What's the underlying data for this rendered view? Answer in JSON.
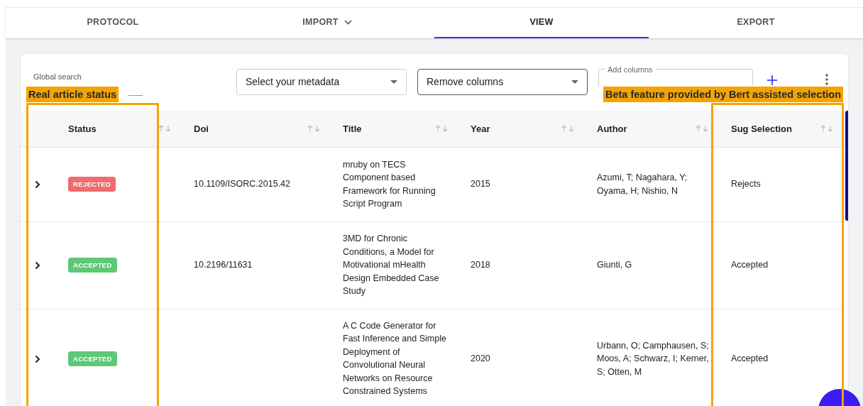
{
  "tabs": [
    {
      "label": "PROTOCOL",
      "selected": false,
      "kind": "plain"
    },
    {
      "label": "IMPORT",
      "selected": false,
      "kind": "dropdown"
    },
    {
      "label": "VIEW",
      "selected": true,
      "kind": "plain"
    },
    {
      "label": "EXPORT",
      "selected": false,
      "kind": "plain"
    }
  ],
  "toolbar": {
    "search_label": "Global search",
    "metadata_select": "Select your metadata",
    "remove_select": "Remove columns",
    "add_columns": {
      "placeholder": "Add columns"
    }
  },
  "table": {
    "columns": [
      "Status",
      "Doi",
      "Title",
      "Year",
      "Author",
      "Sug Selection"
    ],
    "rows": [
      {
        "status": {
          "label": "REJECTED",
          "color": "#ee6b6f"
        },
        "doi": "10.1109/ISORC.2015.42",
        "title": "mruby on TECS Component based Framework for Running Script Program",
        "year": "2015",
        "author": "Azumi, T; Nagahara, Y; Oyama, H; Nishio, N",
        "sug_selection": "Rejects"
      },
      {
        "status": {
          "label": "ACCEPTED",
          "color": "#5ec878"
        },
        "doi": "10.2196/11631",
        "title": "3MD for Chronic Conditions, a Model for Motivational mHealth Design Embedded Case Study",
        "year": "2018",
        "author": "Giunti, G",
        "sug_selection": "Accepted"
      },
      {
        "status": {
          "label": "ACCEPTED",
          "color": "#5ec878"
        },
        "doi": "",
        "title": "A C Code Generator for Fast Inference and Simple Deployment of Convolutional Neural Networks on Resource Constrained Systems",
        "year": "2020",
        "author": "Urbann, O; Camphausen, S; Moos, A; Schwarz, I; Kerner, S; Otten, M",
        "sug_selection": "Accepted"
      }
    ]
  },
  "annotations": [
    {
      "label": "Real article status"
    },
    {
      "label": "Beta feature provided by Bert assisted selection"
    }
  ]
}
